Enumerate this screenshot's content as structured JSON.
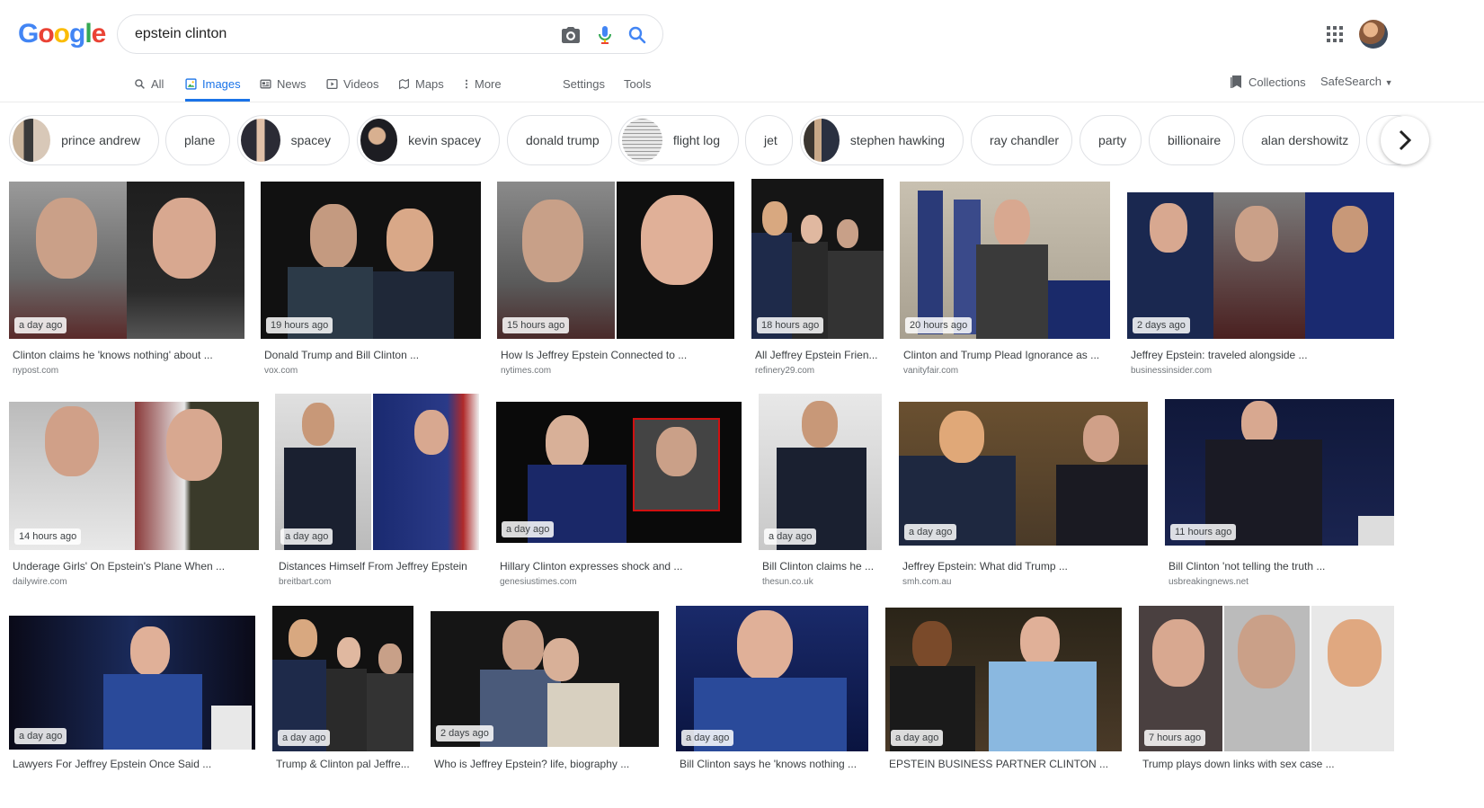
{
  "logo": {
    "letters": [
      "G",
      "o",
      "o",
      "g",
      "l",
      "e"
    ]
  },
  "search": {
    "query": "epstein clinton"
  },
  "tabs": [
    {
      "label": "All"
    },
    {
      "label": "Images"
    },
    {
      "label": "News"
    },
    {
      "label": "Videos"
    },
    {
      "label": "Maps"
    },
    {
      "label": "More"
    }
  ],
  "tools": {
    "settings": "Settings",
    "tools": "Tools",
    "collections": "Collections",
    "safesearch": "SafeSearch"
  },
  "chips": [
    {
      "label": "prince andrew",
      "has_thumb": true
    },
    {
      "label": "plane",
      "has_thumb": false
    },
    {
      "label": "spacey",
      "has_thumb": true
    },
    {
      "label": "kevin spacey",
      "has_thumb": true
    },
    {
      "label": "donald trump",
      "has_thumb": false
    },
    {
      "label": "flight log",
      "has_thumb": true
    },
    {
      "label": "jet",
      "has_thumb": false
    },
    {
      "label": "stephen hawking",
      "has_thumb": true
    },
    {
      "label": "ray chandler",
      "has_thumb": false
    },
    {
      "label": "party",
      "has_thumb": false
    },
    {
      "label": "billionaire",
      "has_thumb": false
    },
    {
      "label": "alan dershowitz",
      "has_thumb": false
    }
  ],
  "results": [
    {
      "time": "a day ago",
      "title": "Clinton claims he 'knows nothing' about ...",
      "source": "nypost.com"
    },
    {
      "time": "19 hours ago",
      "title": "Donald Trump and Bill Clinton ...",
      "source": "vox.com"
    },
    {
      "time": "15 hours ago",
      "title": "How Is Jeffrey Epstein Connected to ...",
      "source": "nytimes.com"
    },
    {
      "time": "18 hours ago",
      "title": "All Jeffrey Epstein Frien...",
      "source": "refinery29.com"
    },
    {
      "time": "20 hours ago",
      "title": "Clinton and Trump Plead Ignorance as ...",
      "source": "vanityfair.com"
    },
    {
      "time": "2 days ago",
      "title": "Jeffrey Epstein: traveled alongside ...",
      "source": "businessinsider.com"
    },
    {
      "time": "14 hours ago",
      "title": "Underage Girls' On Epstein's Plane When ...",
      "source": "dailywire.com"
    },
    {
      "time": "a day ago",
      "title": "Distances Himself From Jeffrey Epstein",
      "source": "breitbart.com"
    },
    {
      "time": "a day ago",
      "title": "Hillary Clinton expresses shock and ...",
      "source": "genesiustimes.com"
    },
    {
      "time": "a day ago",
      "title": "Bill Clinton claims he ...",
      "source": "thesun.co.uk"
    },
    {
      "time": "a day ago",
      "title": "Jeffrey Epstein: What did Trump ...",
      "source": "smh.com.au"
    },
    {
      "time": "11 hours ago",
      "title": "Bill Clinton 'not telling the truth ...",
      "source": "usbreakingnews.net"
    },
    {
      "time": "a day ago",
      "title": "Lawyers For Jeffrey Epstein Once Said ...",
      "source": ""
    },
    {
      "time": "a day ago",
      "title": "Trump & Clinton pal Jeffre...",
      "source": ""
    },
    {
      "time": "2 days ago",
      "title": "Who is Jeffrey Epstein? life, biography ...",
      "source": ""
    },
    {
      "time": "a day ago",
      "title": "Bill Clinton says he 'knows nothing ...",
      "source": ""
    },
    {
      "time": "a day ago",
      "title": "EPSTEIN BUSINESS PARTNER CLINTON ...",
      "source": ""
    },
    {
      "time": "7 hours ago",
      "title": "Trump plays down links with sex case ...",
      "source": ""
    }
  ],
  "colors": {
    "accent": "#1a73e8",
    "text": "#3c4043",
    "muted": "#70757a"
  },
  "icons": [
    "camera-icon",
    "microphone-icon",
    "search-icon",
    "apps-grid-icon",
    "collections-icon",
    "chevron-right-icon"
  ]
}
